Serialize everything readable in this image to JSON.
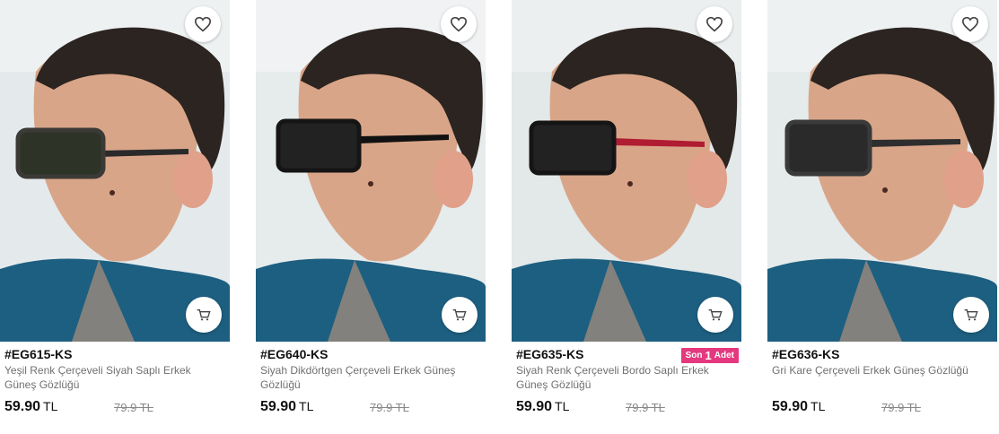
{
  "products": [
    {
      "code": "#EG615-KS",
      "name": "Yeşil Renk Çerçeveli Siyah Saplı Erkek Güneş Gözlüğü",
      "price": "59.90",
      "currency": "TL",
      "old_price": "79.9 TL",
      "frame_color": "#3c3a36",
      "temple_color": "#2a2a2a",
      "lens_color": "#2e3328",
      "badge": null
    },
    {
      "code": "#EG640-KS",
      "name": "Siyah Dikdörtgen Çerçeveli Erkek Güneş Gözlüğü",
      "price": "59.90",
      "currency": "TL",
      "old_price": "79.9 TL",
      "frame_color": "#151515",
      "temple_color": "#111111",
      "lens_color": "#222222",
      "badge": null
    },
    {
      "code": "#EG635-KS",
      "name": "Siyah Renk Çerçeveli Bordo Saplı Erkek Güneş Gözlüğü",
      "price": "59.90",
      "currency": "TL",
      "old_price": "79.9 TL",
      "frame_color": "#151515",
      "temple_color": "#b01c32",
      "lens_color": "#222222",
      "badge": {
        "prefix": "Son",
        "count": "1",
        "suffix": "Adet"
      }
    },
    {
      "code": "#EG636-KS",
      "name": "Gri Kare Çerçeveli Erkek Güneş Gözlüğü",
      "price": "59.90",
      "currency": "TL",
      "old_price": "79.9 TL",
      "frame_color": "#3a3a3a",
      "temple_color": "#2e2e2e",
      "lens_color": "#2a2a2a",
      "badge": null
    }
  ],
  "icons": {
    "favorite": "heart-icon",
    "cart": "cart-icon"
  },
  "colors": {
    "badge": "#e5387e",
    "shirt": "#1d5f80",
    "price": "#111111",
    "old_price": "#888888"
  }
}
